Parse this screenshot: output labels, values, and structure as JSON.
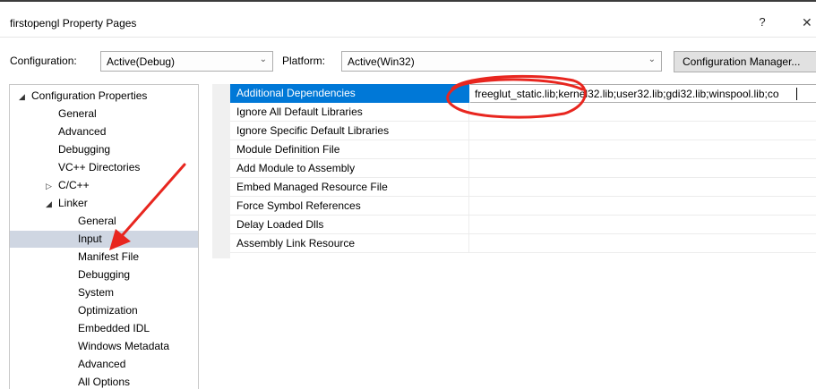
{
  "window": {
    "title": "firstopengl Property Pages",
    "help_label": "?",
    "close_label": "✕"
  },
  "config": {
    "configuration_label": "Configuration:",
    "configuration_value": "Active(Debug)",
    "platform_label": "Platform:",
    "platform_value": "Active(Win32)",
    "manager_label": "Configuration Manager..."
  },
  "tree": {
    "items": [
      {
        "label": "Configuration Properties",
        "expander": "◢"
      },
      {
        "label": "General"
      },
      {
        "label": "Advanced"
      },
      {
        "label": "Debugging"
      },
      {
        "label": "VC++ Directories"
      },
      {
        "label": "C/C++",
        "expander": "▷"
      },
      {
        "label": "Linker",
        "expander": "◢"
      },
      {
        "label": "General"
      },
      {
        "label": "Input",
        "selected": true
      },
      {
        "label": "Manifest File"
      },
      {
        "label": "Debugging"
      },
      {
        "label": "System"
      },
      {
        "label": "Optimization"
      },
      {
        "label": "Embedded IDL"
      },
      {
        "label": "Windows Metadata"
      },
      {
        "label": "Advanced"
      },
      {
        "label": "All Options"
      }
    ]
  },
  "properties": [
    {
      "name": "Additional Dependencies",
      "value": "freeglut_static.lib;kernel32.lib;user32.lib;gdi32.lib;winspool.lib;co",
      "selected": true
    },
    {
      "name": "Ignore All Default Libraries",
      "value": ""
    },
    {
      "name": "Ignore Specific Default Libraries",
      "value": ""
    },
    {
      "name": "Module Definition File",
      "value": ""
    },
    {
      "name": "Add Module to Assembly",
      "value": ""
    },
    {
      "name": "Embed Managed Resource File",
      "value": ""
    },
    {
      "name": "Force Symbol References",
      "value": ""
    },
    {
      "name": "Delay Loaded Dlls",
      "value": ""
    },
    {
      "name": "Assembly Link Resource",
      "value": ""
    }
  ],
  "colors": {
    "selection_blue": "#0078d7",
    "tree_selection": "#cfd6e2",
    "annotation_red": "#e8261f"
  },
  "icons": {
    "combo_arrow": "chevron-down-icon",
    "tree_expanded": "triangle-expanded-icon",
    "tree_collapsed": "triangle-collapsed-icon"
  }
}
